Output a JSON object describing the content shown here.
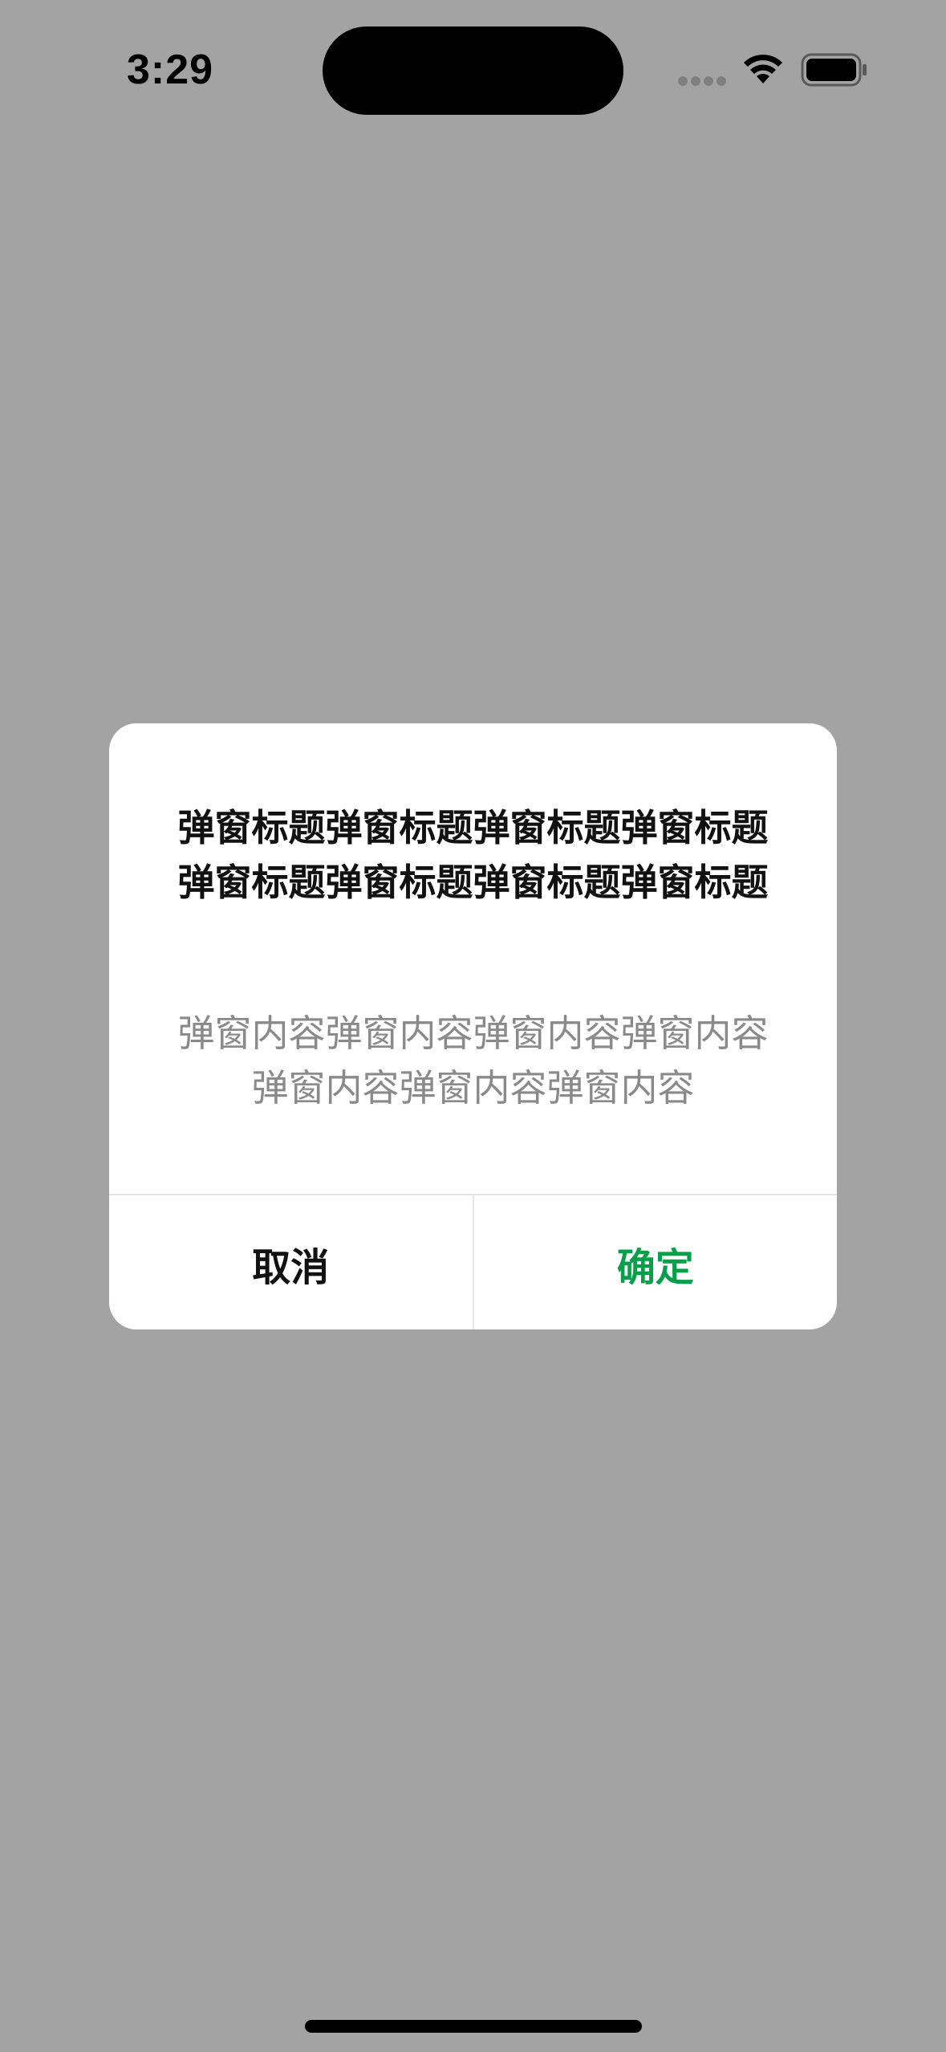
{
  "status_bar": {
    "time": "3:29",
    "icons": [
      "signal-dots-icon",
      "wifi-icon",
      "battery-icon"
    ]
  },
  "dialog": {
    "title": "弹窗标题弹窗标题弹窗标题弹窗标题弹窗标题弹窗标题弹窗标题弹窗标题",
    "content": "弹窗内容弹窗内容弹窗内容弹窗内容弹窗内容弹窗内容弹窗内容",
    "cancel_label": "取消",
    "confirm_label": "确定"
  },
  "colors": {
    "overlay_background": "#a3a3a3",
    "dialog_background": "#ffffff",
    "confirm_accent": "#07a04a",
    "content_text": "#8a8a8a"
  }
}
